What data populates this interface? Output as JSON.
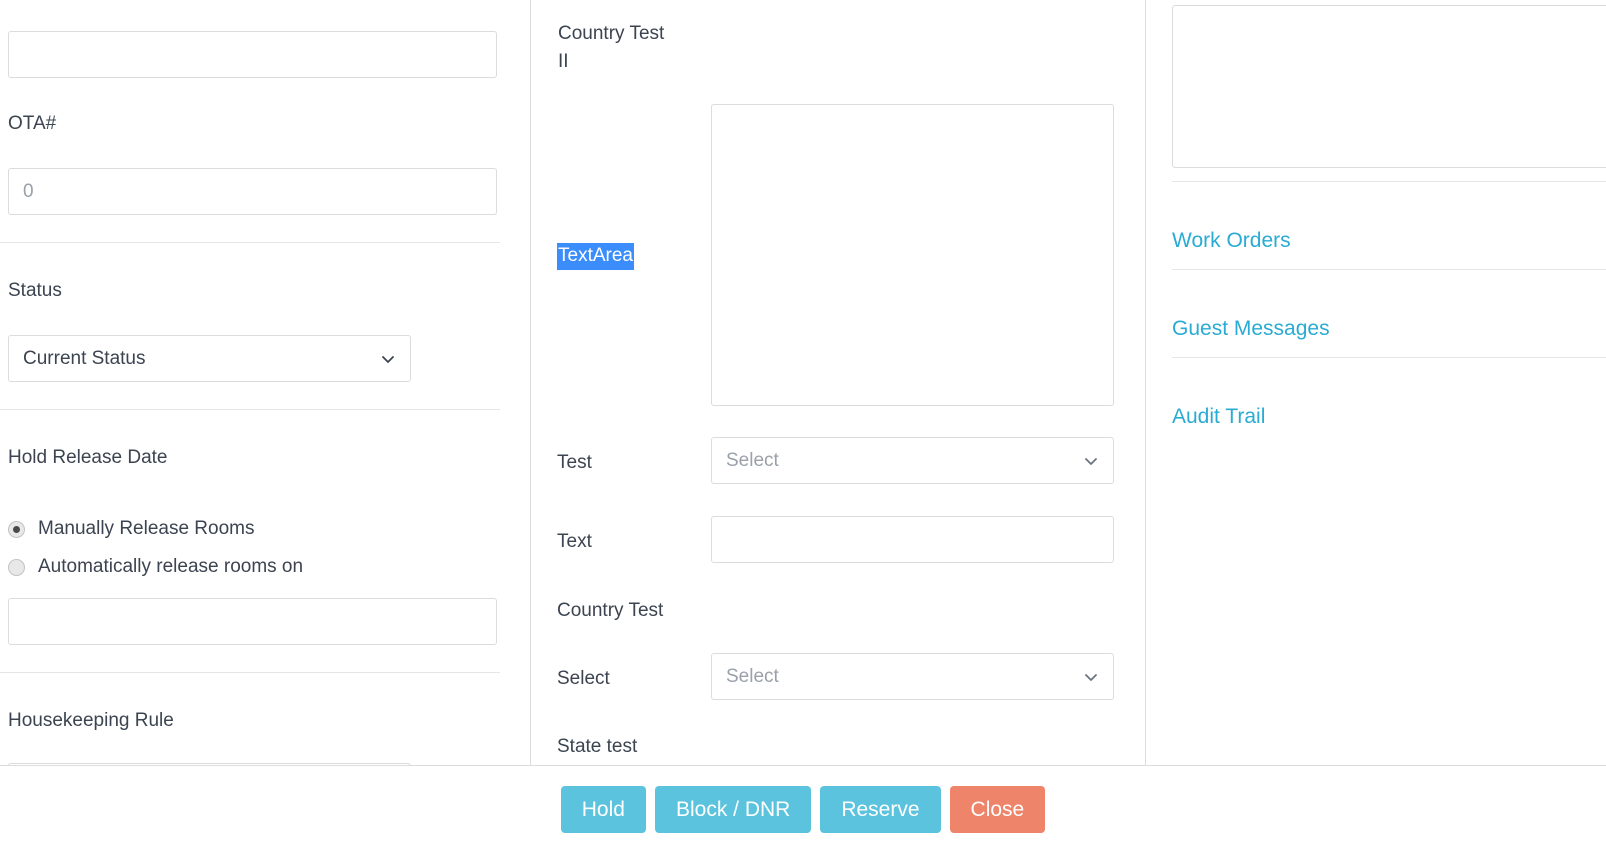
{
  "left_panel": {
    "top_input": {
      "value": "",
      "placeholder": ""
    },
    "ota_label": "OTA#",
    "ota_input": {
      "value": "",
      "placeholder": "0"
    },
    "status_label": "Status",
    "status_select": {
      "value": "Current Status"
    },
    "hold_release_label": "Hold Release Date",
    "radio_manual_label": "Manually Release Rooms",
    "radio_auto_label": "Automatically release rooms on",
    "release_date_input": {
      "value": "",
      "placeholder": ""
    },
    "housekeeping_label": "Housekeeping Rule",
    "housekeeping_input": {
      "value": "",
      "placeholder": ""
    }
  },
  "middle_panel": {
    "country_test_2_label": "Country Test\nII",
    "textarea_label": "TextArea",
    "textarea": {
      "value": "",
      "placeholder": ""
    },
    "test_label": "Test",
    "test_select": {
      "value": "Select"
    },
    "text_label": "Text",
    "text_input": {
      "value": "",
      "placeholder": ""
    },
    "country_test_label": "Country Test",
    "select_label": "Select",
    "select_select": {
      "value": "Select"
    },
    "state_test_label": "State test"
  },
  "right_panel": {
    "notes_box": {
      "value": "",
      "placeholder": ""
    },
    "links": [
      {
        "label": "Work Orders"
      },
      {
        "label": "Guest Messages"
      },
      {
        "label": "Audit Trail"
      }
    ]
  },
  "footer": {
    "buttons": [
      {
        "label": "Hold",
        "style": "blue"
      },
      {
        "label": "Block / DNR",
        "style": "blue"
      },
      {
        "label": "Reserve",
        "style": "blue"
      },
      {
        "label": "Close",
        "style": "salmon"
      }
    ]
  },
  "colors": {
    "primary_button": "#5bc3dd",
    "close_button": "#ee8469",
    "link": "#29abd4",
    "selection_highlight": "#3b8dfb",
    "text": "#3b4450",
    "border": "#dcdcdc"
  }
}
